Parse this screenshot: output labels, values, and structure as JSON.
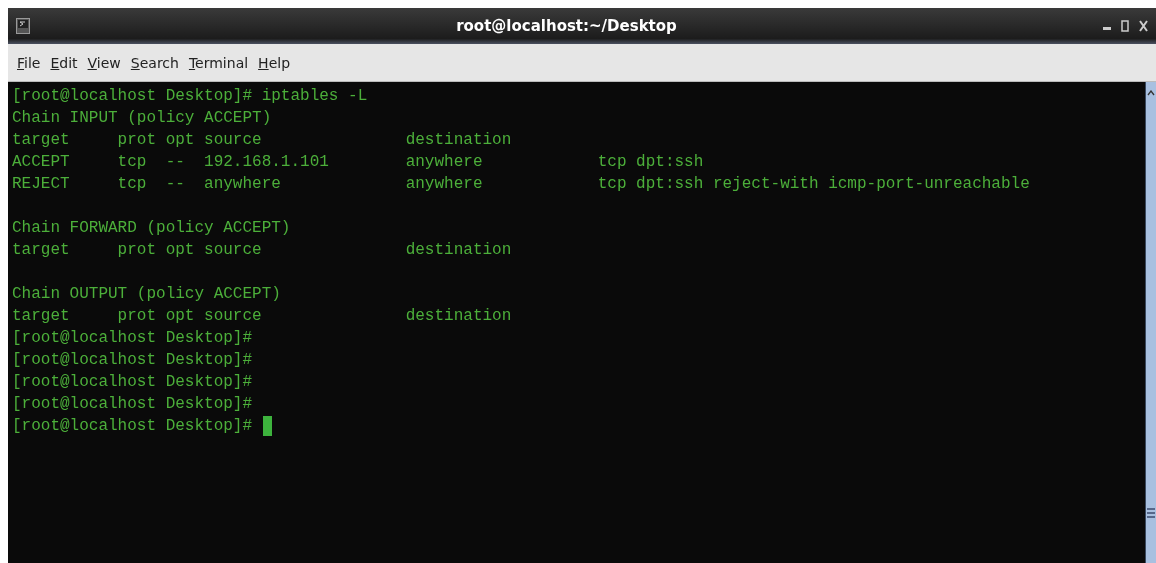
{
  "window": {
    "title": "root@localhost:~/Desktop"
  },
  "menu": [
    "File",
    "Edit",
    "View",
    "Search",
    "Terminal",
    "Help"
  ],
  "terminal": {
    "cursor": true,
    "blocks": [
      [
        "[root@localhost Desktop]# iptables -L",
        "Chain INPUT (policy ACCEPT)",
        "target     prot opt source               destination",
        "ACCEPT     tcp  --  192.168.1.101        anywhere            tcp dpt:ssh",
        "REJECT     tcp  --  anywhere             anywhere            tcp dpt:ssh reject-with icmp-port-unreachable"
      ],
      [
        "Chain FORWARD (policy ACCEPT)",
        "target     prot opt source               destination"
      ],
      [
        "Chain OUTPUT (policy ACCEPT)",
        "target     prot opt source               destination",
        "[root@localhost Desktop]#",
        "[root@localhost Desktop]#",
        "[root@localhost Desktop]#",
        "[root@localhost Desktop]#",
        "[root@localhost Desktop]# "
      ]
    ]
  }
}
